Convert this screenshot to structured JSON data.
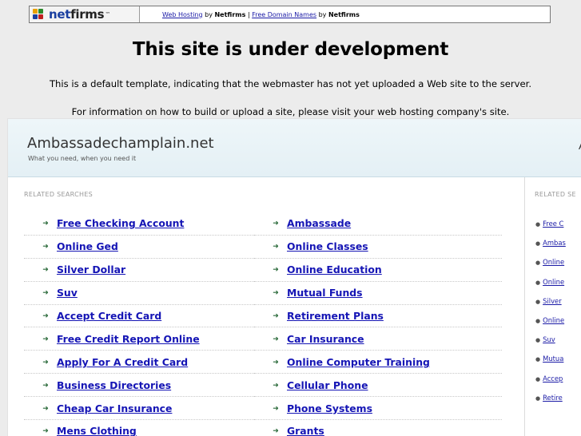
{
  "topbar": {
    "logo_text": "netfirms",
    "logo_trademark": "™",
    "link1": "Web Hosting",
    "by1": " by ",
    "brand1": "Netfirms",
    "separator": " | ",
    "link2": "Free Domain Names",
    "by2": " by ",
    "brand2": "Netfirms"
  },
  "headline": "This site is under development",
  "message1": "This is a default template, indicating that the webmaster has not yet uploaded a Web site to the server.",
  "message2": "For information on how to build or upload a site, please visit your web hosting company's site.",
  "frame": {
    "domain": "Ambassadechamplain.net",
    "tagline": "What you need, when you need it",
    "header_edge": "A",
    "related_label": "RELATED SEARCHES",
    "side_label": "RELATED SE",
    "left_items": [
      "Free Checking Account",
      "Online Ged",
      "Silver Dollar",
      "Suv",
      "Accept Credit Card",
      "Free Credit Report Online",
      "Apply For A Credit Card",
      "Business Directories",
      "Cheap Car Insurance",
      "Mens Clothing"
    ],
    "right_items": [
      "Ambassade",
      "Online Classes",
      "Online Education",
      "Mutual Funds",
      "Retirement Plans",
      "Car Insurance",
      "Online Computer Training",
      "Cellular Phone",
      "Phone Systems",
      "Grants"
    ],
    "side_items": [
      "Free C",
      "Ambas",
      "Online",
      "Online",
      "Silver",
      "Online",
      "Suv",
      "Mutua",
      "Accep",
      "Retire"
    ]
  },
  "colors": {
    "link": "#1515b5",
    "arrow": "#2a6a3a",
    "header_bg": "#e4f0f5"
  }
}
